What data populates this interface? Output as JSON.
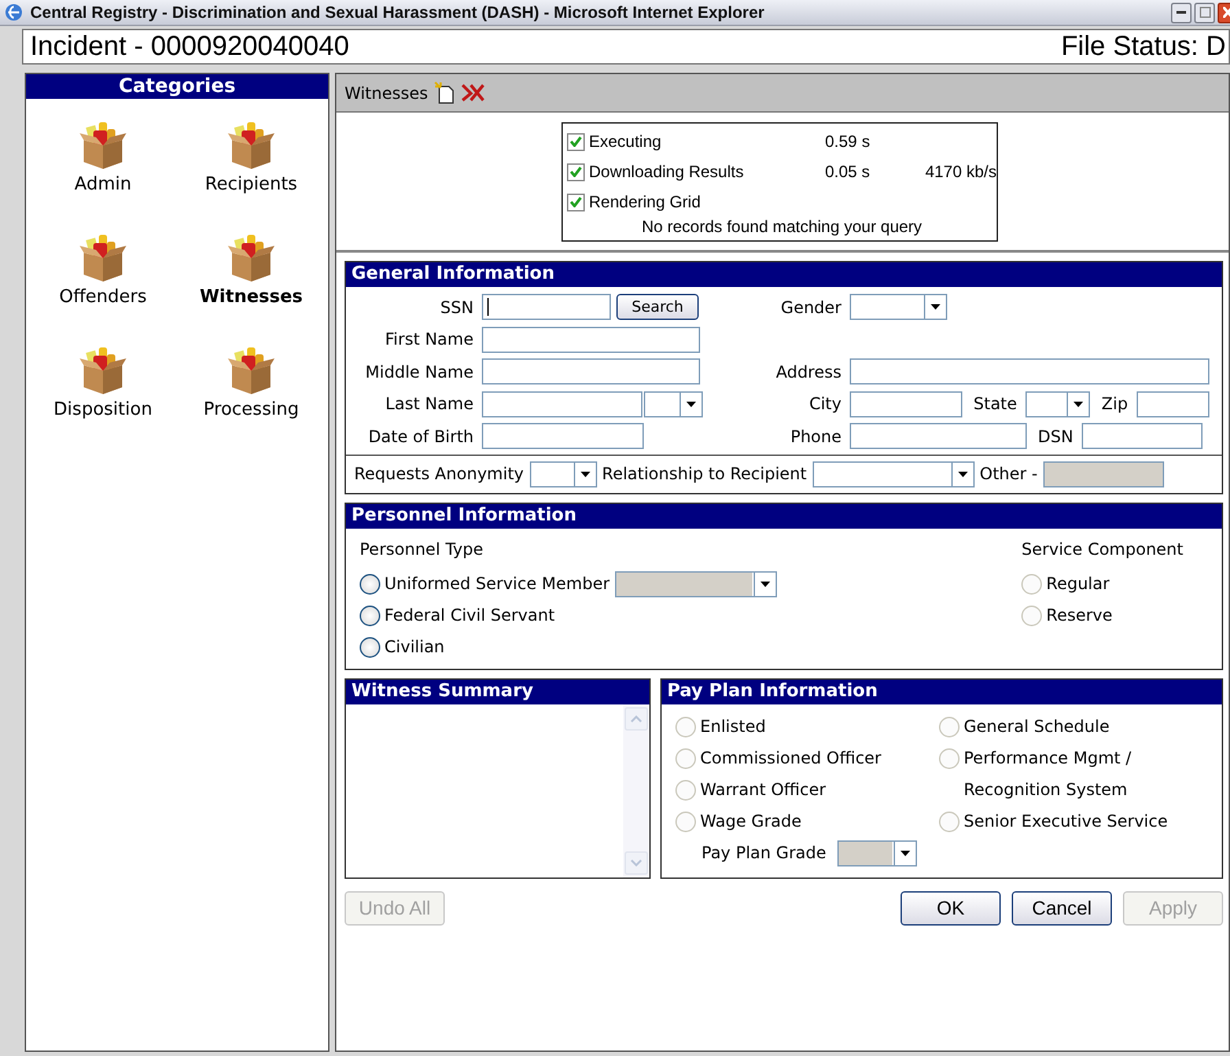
{
  "window": {
    "title": "Central Registry - Discrimination and Sexual Harassment (DASH) - Microsoft Internet Explorer"
  },
  "header": {
    "incident": "Incident - 0000920040040",
    "file_status": "File Status: D"
  },
  "categories": {
    "title": "Categories",
    "items": [
      {
        "label": "Admin",
        "selected": false
      },
      {
        "label": "Recipients",
        "selected": false
      },
      {
        "label": "Offenders",
        "selected": false
      },
      {
        "label": "Witnesses",
        "selected": true
      },
      {
        "label": "Disposition",
        "selected": false
      },
      {
        "label": "Processing",
        "selected": false
      }
    ]
  },
  "toolbar": {
    "label": "Witnesses"
  },
  "query_status": {
    "steps": [
      {
        "label": "Executing",
        "checked": true,
        "time": "0.59 s"
      },
      {
        "label": "Downloading Results",
        "checked": true,
        "time": "0.05 s",
        "rate": "4170 kb/s"
      },
      {
        "label": "Rendering Grid",
        "checked": true
      }
    ],
    "message": "No records found matching your query"
  },
  "general_information": {
    "title": "General Information",
    "ssn_label": "SSN",
    "search_button": "Search",
    "gender_label": "Gender",
    "first_name_label": "First Name",
    "middle_name_label": "Middle Name",
    "address_label": "Address",
    "last_name_label": "Last Name",
    "city_label": "City",
    "state_label": "State",
    "zip_label": "Zip",
    "dob_label": "Date of Birth",
    "phone_label": "Phone",
    "dsn_label": "DSN",
    "anonymity_label": "Requests Anonymity",
    "relationship_label": "Relationship to Recipient",
    "other_label": "Other -",
    "other_disabled": true
  },
  "personnel_information": {
    "title": "Personnel Information",
    "type_label": "Personnel Type",
    "types": [
      {
        "label": "Uniformed Service Member",
        "selected": false
      },
      {
        "label": "Federal Civil Servant",
        "selected": false
      },
      {
        "label": "Civilian",
        "selected": false
      }
    ],
    "member_select_disabled": true,
    "component_label": "Service Component",
    "components": [
      {
        "label": "Regular",
        "selected": false,
        "disabled": true
      },
      {
        "label": "Reserve",
        "selected": false,
        "disabled": true
      }
    ]
  },
  "witness_summary": {
    "title": "Witness Summary"
  },
  "pay_plan_information": {
    "title": "Pay Plan Information",
    "columns": [
      [
        {
          "label": "Enlisted",
          "selected": false,
          "disabled": true
        },
        {
          "label": "Commissioned Officer",
          "selected": false,
          "disabled": true
        },
        {
          "label": "Warrant Officer",
          "selected": false,
          "disabled": true
        },
        {
          "label": "Wage Grade",
          "selected": false,
          "disabled": true
        }
      ],
      [
        {
          "label": "General Schedule",
          "selected": false,
          "disabled": true
        },
        {
          "label": "Performance Mgmt / Recognition System",
          "selected": false,
          "disabled": true
        },
        {
          "label": "Senior Executive Service",
          "selected": false,
          "disabled": true
        }
      ]
    ],
    "grade_label": "Pay Plan Grade",
    "grade_disabled": true
  },
  "undo_button": {
    "label": "Undo All",
    "disabled": true
  },
  "dialog_buttons": [
    {
      "label": "OK",
      "disabled": false
    },
    {
      "label": "Cancel",
      "disabled": false
    },
    {
      "label": "Apply",
      "disabled": true
    }
  ]
}
